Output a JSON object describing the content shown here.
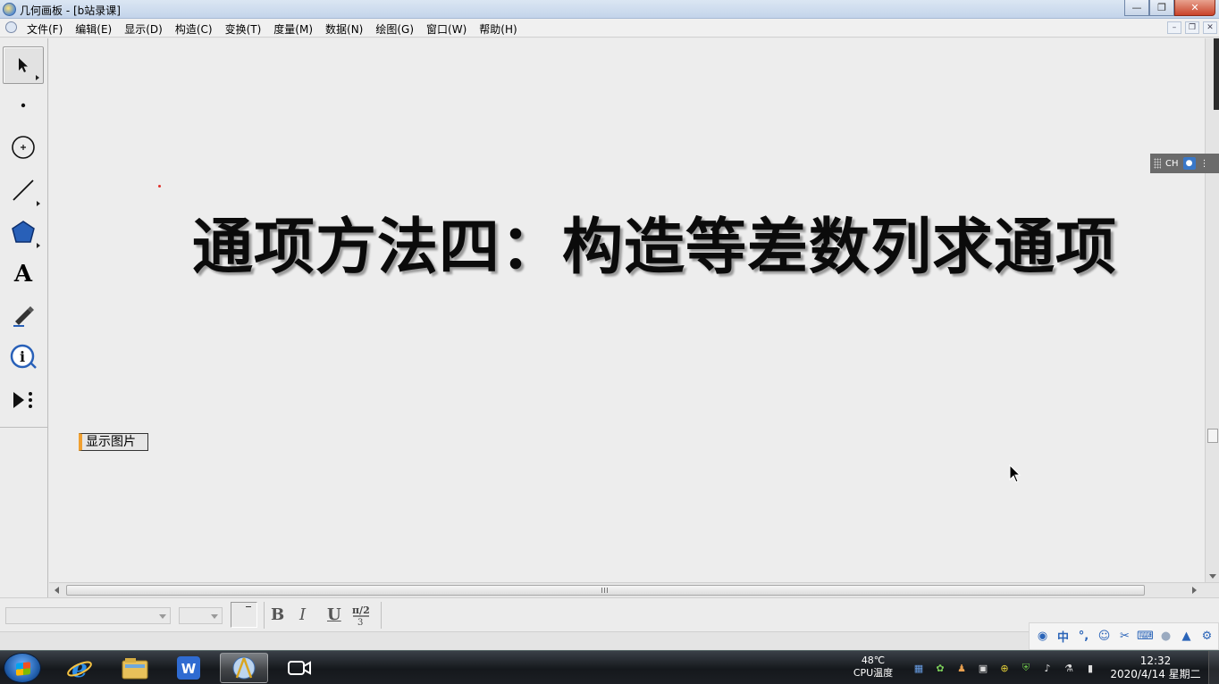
{
  "window": {
    "title": "几何画板 - [b站录课]",
    "minimize_glyph": "—",
    "maximize_glyph": "❐",
    "close_glyph": "✕"
  },
  "menu": {
    "items": [
      "文件(F)",
      "编辑(E)",
      "显示(D)",
      "构造(C)",
      "变换(T)",
      "度量(M)",
      "数据(N)",
      "绘图(G)",
      "窗口(W)",
      "帮助(H)"
    ],
    "mdi_min": "–",
    "mdi_restore": "❐",
    "mdi_close": "✕"
  },
  "toolbox": {
    "tools": [
      "arrow-select-tool",
      "point-tool",
      "compass-tool",
      "straightedge-tool",
      "polygon-tool",
      "text-tool",
      "marker-tool",
      "information-tool",
      "custom-tool"
    ],
    "text_tool_glyph": "A"
  },
  "canvas": {
    "title": "通项方法四：构造等差数列求通项",
    "show_image_button": "显示图片"
  },
  "ime_bar": {
    "label": "CH"
  },
  "format_bar": {
    "font_value": "",
    "size_value": "",
    "bold": "B",
    "italic": "I",
    "underline": "U"
  },
  "ime_tray": {
    "chinese_mode": "中",
    "punct": "°,"
  },
  "taskbar": {
    "apps": [
      "internet-explorer",
      "file-explorer",
      "wps-writer",
      "geometers-sketchpad",
      "screen-recorder"
    ],
    "active_app": "geometers-sketchpad",
    "cpu_temp": "48℃",
    "cpu_label": "CPU温度",
    "time": "12:32",
    "date": "2020/4/14 星期二"
  },
  "colors": {
    "accent_orange": "#f0a030",
    "point_red": "#e0302a",
    "taskbar_dark": "#15181c"
  }
}
